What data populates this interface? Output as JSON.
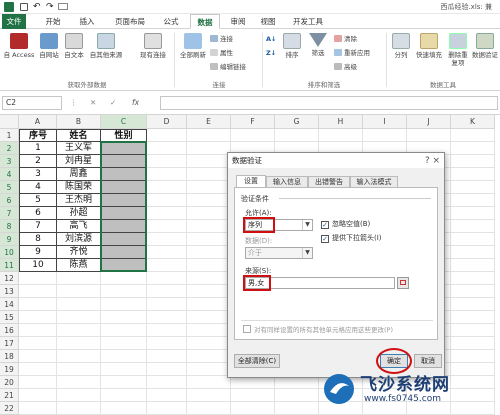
{
  "titlebar": {
    "filename": "西瓜经验.xls: 兼"
  },
  "tabs": [
    {
      "label": "文件",
      "type": "file"
    },
    {
      "label": "开始"
    },
    {
      "label": "插入"
    },
    {
      "label": "页面布局"
    },
    {
      "label": "公式"
    },
    {
      "label": "数据",
      "active": true
    },
    {
      "label": "审阅"
    },
    {
      "label": "视图"
    },
    {
      "label": "开发工具"
    }
  ],
  "ribbon": {
    "btn_access": "自 Access",
    "btn_web": "自网站",
    "btn_text": "自文本",
    "btn_other": "自其他来源",
    "btn_existing": "现有连接",
    "group_external": "获取外部数据",
    "btn_refresh": "全部刷新",
    "small_connections": "连接",
    "small_properties": "属性",
    "small_editlinks": "编辑链接",
    "group_connections": "连接",
    "btn_sort": "排序",
    "btn_filter": "筛选",
    "small_clear": "清除",
    "small_reapply": "重新应用",
    "small_advanced": "高级",
    "group_sortfilter": "排序和筛选",
    "btn_split": "分列",
    "btn_flashfill": "快速填充",
    "btn_dedupe": "删除重复项",
    "btn_validate": "数据验证",
    "group_datatools": "数据工具"
  },
  "formula": {
    "namebox": "C2",
    "fx": "fx",
    "value": ""
  },
  "grid": {
    "columns": [
      "A",
      "B",
      "C",
      "D",
      "E",
      "F",
      "G",
      "H",
      "I",
      "J",
      "K"
    ],
    "rows": [
      "1",
      "2",
      "3",
      "4",
      "5",
      "6",
      "7",
      "8",
      "9",
      "10",
      "11",
      "12",
      "13",
      "14",
      "15",
      "16",
      "17",
      "18",
      "19",
      "20",
      "21",
      "22"
    ],
    "header": [
      "序号",
      "姓名",
      "性别"
    ],
    "data": [
      [
        "1",
        "王义军"
      ],
      [
        "2",
        "刘冉星"
      ],
      [
        "3",
        "周鑫"
      ],
      [
        "4",
        "陈国荣"
      ],
      [
        "5",
        "王杰明"
      ],
      [
        "6",
        "孙超"
      ],
      [
        "7",
        "高飞"
      ],
      [
        "8",
        "刘滨源"
      ],
      [
        "9",
        "齐悦"
      ],
      [
        "10",
        "陈燕"
      ]
    ]
  },
  "dialog": {
    "title": "数据验证",
    "close": "?  ×",
    "tabs": [
      "设置",
      "输入信息",
      "出错警告",
      "输入法模式"
    ],
    "criteria_label": "验证条件",
    "allow_label": "允许(A):",
    "allow_value": "序列",
    "ignore_blank": "忽略空值(B)",
    "dropdown": "提供下拉箭头(I)",
    "data_label": "数据(D):",
    "data_value": "介于",
    "source_label": "来源(S):",
    "source_value": "男,女",
    "apply_all": "对有同样设置的所有其他单元格应用这些更改(P)",
    "btn_clear": "全部清除(C)",
    "btn_ok": "确定",
    "btn_cancel": "取消"
  },
  "watermark": {
    "title": "飞沙系统网",
    "url": "www.fs0745.com"
  },
  "colors": {
    "accent": "#217346",
    "highlight": "#d01010",
    "gray_fill": "#bfbfbf"
  }
}
